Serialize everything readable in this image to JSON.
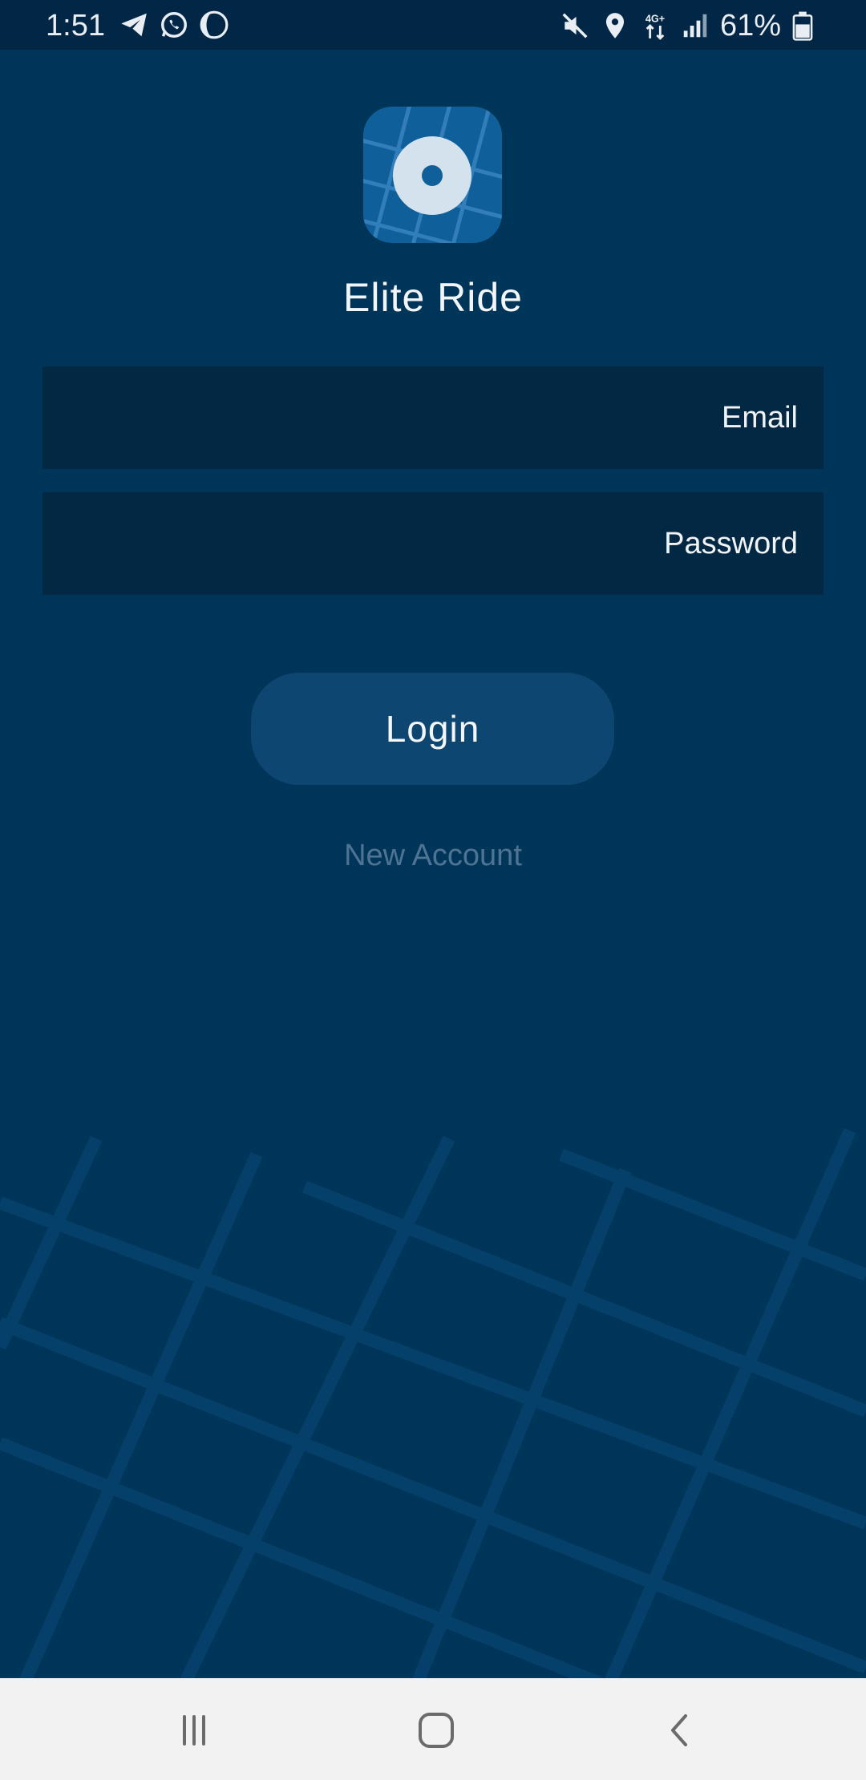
{
  "status_bar": {
    "time": "1:51",
    "battery_percent": "61%",
    "network_label": "4G+",
    "left_icons": [
      "telegram-icon",
      "whatsapp-icon",
      "night-mode-icon"
    ],
    "right_icons": [
      "mute-icon",
      "location-icon",
      "network-4g-icon",
      "signal-icon",
      "battery-icon"
    ]
  },
  "app": {
    "title": "Elite Ride",
    "logo_icon": "app-logo-icon"
  },
  "form": {
    "email_placeholder": "Email",
    "password_placeholder": "Password",
    "login_label": "Login",
    "new_account_label": "New Account"
  },
  "nav_bar": {
    "icons": [
      "recents-icon",
      "home-icon",
      "back-icon"
    ]
  },
  "colors": {
    "background": "#00355a",
    "status_bar": "#022645",
    "input_background": "#022843",
    "button_background": "#0d4670",
    "link_text": "#4f7493",
    "nav_bar": "#f2f2f2"
  }
}
